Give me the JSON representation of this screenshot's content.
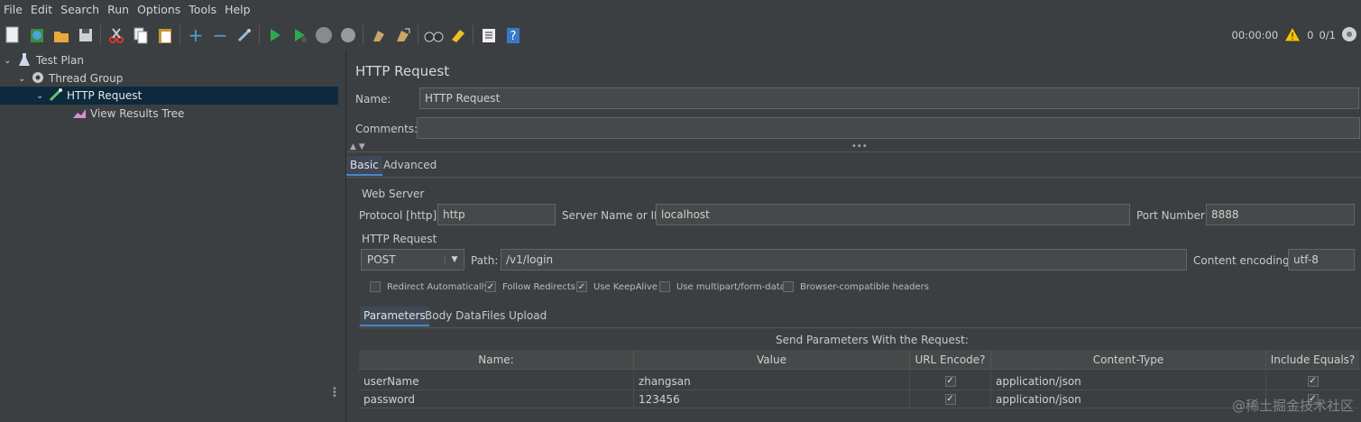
{
  "menu": [
    "File",
    "Edit",
    "Search",
    "Run",
    "Options",
    "Tools",
    "Help"
  ],
  "status": {
    "time": "00:00:00",
    "warnings": "0",
    "threads": "0/1"
  },
  "tree": [
    {
      "label": "Test Plan"
    },
    {
      "label": "Thread Group"
    },
    {
      "label": "HTTP Request"
    },
    {
      "label": "View Results Tree"
    }
  ],
  "panel": {
    "title": "HTTP Request",
    "name_label": "Name:",
    "name_value": "HTTP Request",
    "comments_label": "Comments:",
    "comments_value": "",
    "tabs": [
      "Basic",
      "Advanced"
    ],
    "web_server": {
      "section": "Web Server",
      "protocol_label": "Protocol [http]:",
      "protocol": "http",
      "server_label": "Server Name or IP:",
      "server": "localhost",
      "port_label": "Port Number:",
      "port": "8888"
    },
    "http_request": {
      "section": "HTTP Request",
      "method": "POST",
      "path_label": "Path:",
      "path": "/v1/login",
      "encoding_label": "Content encoding:",
      "encoding": "utf-8"
    },
    "options": [
      {
        "label": "Redirect Automatically",
        "checked": false
      },
      {
        "label": "Follow Redirects",
        "checked": true
      },
      {
        "label": "Use KeepAlive",
        "checked": true
      },
      {
        "label": "Use multipart/form-data",
        "checked": false
      },
      {
        "label": "Browser-compatible headers",
        "checked": false
      }
    ],
    "subtabs": [
      "Parameters",
      "Body Data",
      "Files Upload"
    ],
    "params_title": "Send Parameters With the Request:",
    "columns": [
      "Name:",
      "Value",
      "URL Encode?",
      "Content-Type",
      "Include Equals?"
    ],
    "rows": [
      {
        "name": "userName",
        "value": "zhangsan",
        "encode": true,
        "type": "application/json",
        "equals": true
      },
      {
        "name": "password",
        "value": "123456",
        "encode": true,
        "type": "application/json",
        "equals": true
      }
    ]
  },
  "watermark": "@稀土掘金技术社区"
}
